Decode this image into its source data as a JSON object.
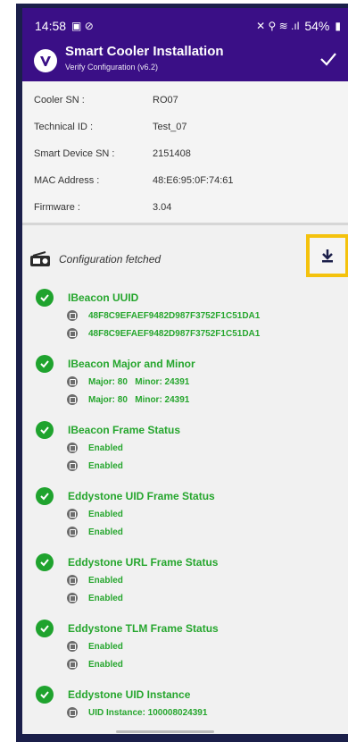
{
  "status_bar": {
    "time": "14:58",
    "battery": "54%"
  },
  "app": {
    "title": "Smart Cooler Installation",
    "subtitle": "Verify Configuration (v6.2)"
  },
  "info": [
    {
      "label": "Cooler SN :",
      "value": "RO07"
    },
    {
      "label": "Technical ID :",
      "value": "Test_07"
    },
    {
      "label": "Smart Device SN :",
      "value": "2151408"
    },
    {
      "label": "MAC Address :",
      "value": "48:E6:95:0F:74:61"
    },
    {
      "label": "Firmware :",
      "value": "3.04"
    }
  ],
  "config": {
    "header": "Configuration fetched",
    "sections": [
      {
        "title": "IBeacon UUID",
        "values": [
          "48F8C9EFAEF9482D987F3752F1C51DA1",
          "48F8C9EFAEF9482D987F3752F1C51DA1"
        ]
      },
      {
        "title": "IBeacon Major and Minor",
        "values": [
          "Major: 80   Minor: 24391",
          "Major: 80   Minor: 24391"
        ]
      },
      {
        "title": "IBeacon Frame Status",
        "values": [
          "Enabled",
          "Enabled"
        ]
      },
      {
        "title": "Eddystone UID Frame Status",
        "values": [
          "Enabled",
          "Enabled"
        ]
      },
      {
        "title": "Eddystone URL Frame Status",
        "values": [
          "Enabled",
          "Enabled"
        ]
      },
      {
        "title": "Eddystone TLM Frame Status",
        "values": [
          "Enabled",
          "Enabled"
        ]
      },
      {
        "title": "Eddystone UID Instance",
        "values": [
          "UID Instance: 100008024391"
        ]
      }
    ]
  },
  "colors": {
    "appbar": "#3a0f86",
    "success": "#26a62e",
    "highlight": "#f4c20d"
  },
  "icons": [
    "verify-check-icon",
    "radio-icon",
    "download-icon",
    "success-check-icon"
  ]
}
